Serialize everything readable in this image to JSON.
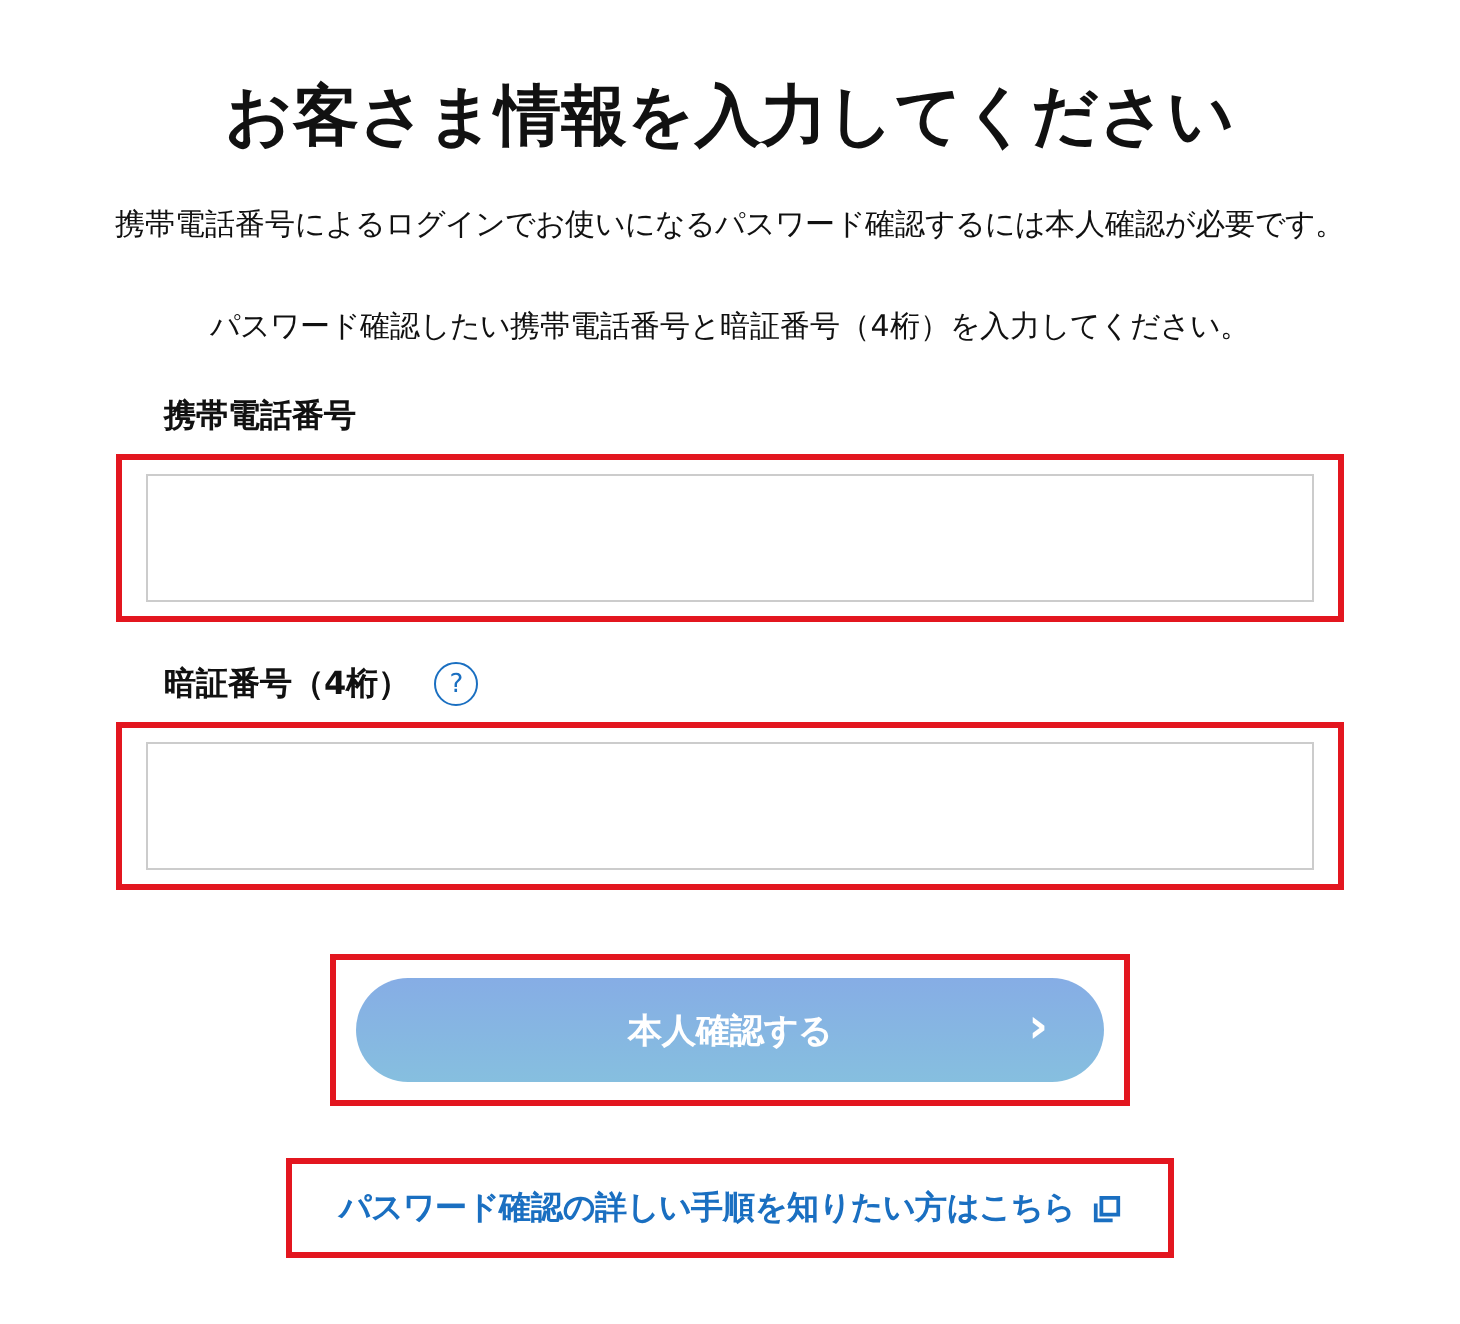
{
  "title": "お客さま情報を入力してください",
  "descriptions": [
    "携帯電話番号によるログインでお使いになるパスワード確認するには本人確認が必要です。",
    "パスワード確認したい携帯電話番号と暗証番号（4桁）を入力してください。"
  ],
  "fields": [
    {
      "label": "携帯電話番号",
      "highlighted": true
    },
    {
      "label": "暗証番号（4桁）",
      "help": "?",
      "highlighted": true
    }
  ],
  "submit_button": {
    "label": "本人確認する",
    "icon": "›",
    "disabled": true,
    "highlighted": true
  },
  "help_link": {
    "label": "パスワード確認の詳しい手順を知りたい方はこちら",
    "highlighted": true
  }
}
